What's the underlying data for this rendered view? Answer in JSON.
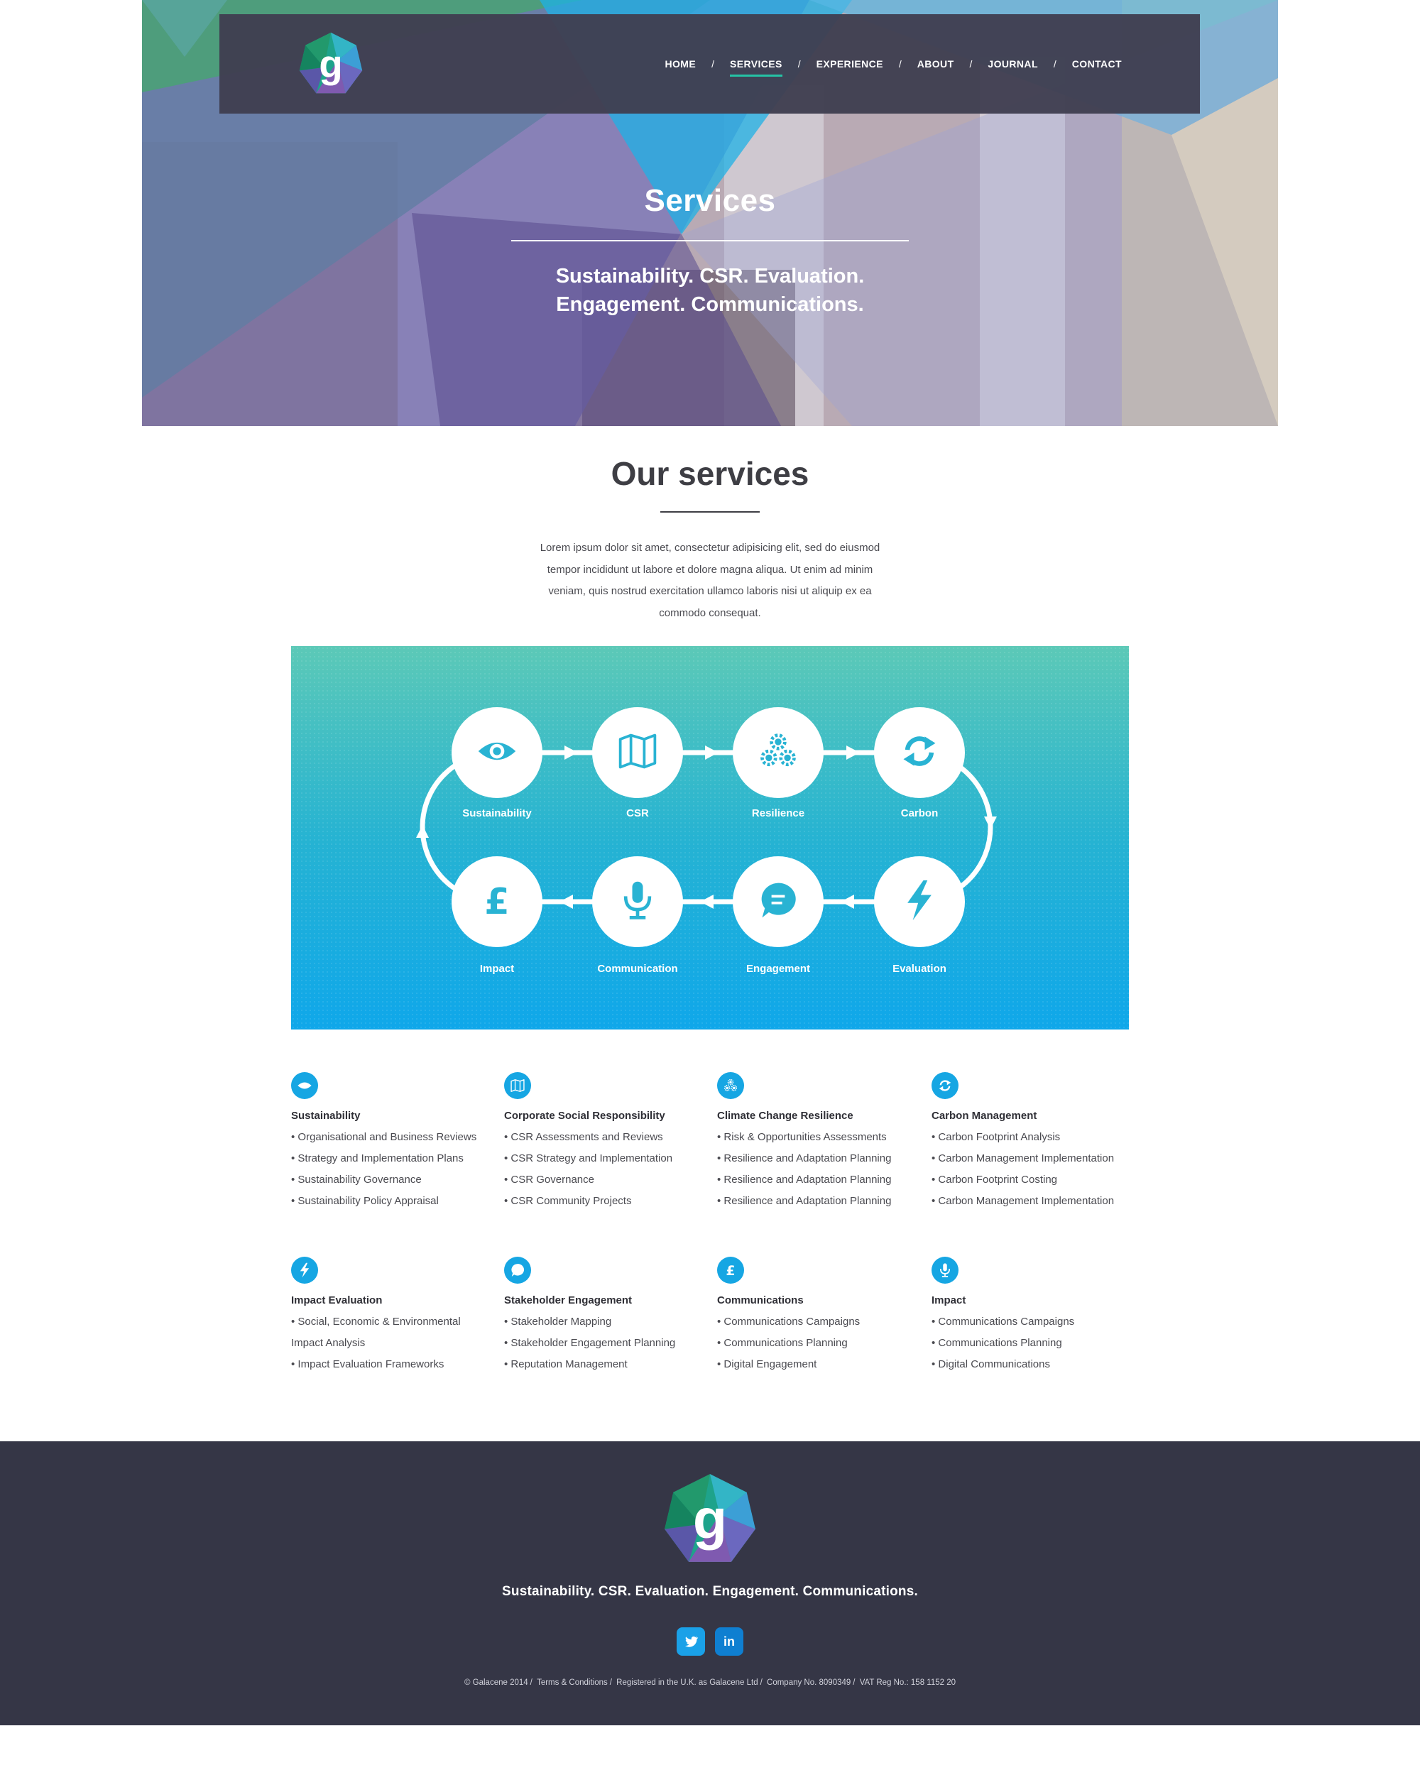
{
  "header": {
    "logo_letter": "g",
    "nav": [
      {
        "label": "HOME",
        "active": false
      },
      {
        "label": "SERVICES",
        "active": true
      },
      {
        "label": "EXPERIENCE",
        "active": false
      },
      {
        "label": "ABOUT",
        "active": false
      },
      {
        "label": "JOURNAL",
        "active": false
      },
      {
        "label": "CONTACT",
        "active": false
      }
    ],
    "nav_separator": "/"
  },
  "hero": {
    "title": "Services",
    "subtitle_line1": "Sustainability. CSR. Evaluation.",
    "subtitle_line2": "Engagement. Communications."
  },
  "services_intro": {
    "title": "Our services",
    "body": "Lorem ipsum dolor sit amet, consectetur adipisicing elit, sed do eiusmod tempor incididunt ut labore et dolore magna aliqua. Ut enim ad minim veniam, quis nostrud exercitation ullamco laboris nisi ut aliquip ex ea commodo consequat."
  },
  "diagram": {
    "top_row": [
      {
        "label": "Sustainability",
        "icon": "eye-icon"
      },
      {
        "label": "CSR",
        "icon": "map-icon"
      },
      {
        "label": "Resilience",
        "icon": "gears-icon"
      },
      {
        "label": "Carbon",
        "icon": "recycle-icon"
      }
    ],
    "bottom_row": [
      {
        "label": "Impact",
        "icon": "pound-icon"
      },
      {
        "label": "Communication",
        "icon": "microphone-icon"
      },
      {
        "label": "Engagement",
        "icon": "speech-bubble-icon"
      },
      {
        "label": "Evaluation",
        "icon": "lightning-icon"
      }
    ],
    "colors": {
      "gradient_top": "#5cc9b7",
      "gradient_bottom": "#0fa7ea"
    }
  },
  "service_columns": [
    {
      "icon": "eye-icon",
      "title": "Sustainability",
      "items": [
        "• Organisational and Business Reviews",
        "• Strategy and Implementation Plans",
        "• Sustainability Governance",
        "• Sustainability Policy Appraisal"
      ]
    },
    {
      "icon": "map-icon",
      "title": "Corporate Social Responsibility",
      "items": [
        "• CSR Assessments and Reviews",
        "• CSR Strategy and Implementation",
        "• CSR Governance",
        "• CSR Community Projects"
      ]
    },
    {
      "icon": "gears-icon",
      "title": "Climate Change Resilience",
      "items": [
        "• Risk & Opportunities Assessments",
        "• Resilience and Adaptation Planning",
        "• Resilience and Adaptation Planning",
        "• Resilience and Adaptation Planning"
      ]
    },
    {
      "icon": "recycle-icon",
      "title": "Carbon Management",
      "items": [
        "• Carbon Footprint Analysis",
        "• Carbon Management Implementation",
        "• Carbon Footprint Costing",
        "• Carbon Management Implementation"
      ]
    },
    {
      "icon": "lightning-icon",
      "title": "Impact Evaluation",
      "items": [
        "• Social, Economic & Environmental",
        "Impact Analysis",
        "• Impact Evaluation Frameworks"
      ]
    },
    {
      "icon": "speech-bubble-icon",
      "title": "Stakeholder Engagement",
      "items": [
        "• Stakeholder Mapping",
        "• Stakeholder Engagement Planning",
        "• Reputation Management"
      ]
    },
    {
      "icon": "pound-icon",
      "title": "Communications",
      "items": [
        "• Communications Campaigns",
        "• Communications Planning",
        "• Digital Engagement"
      ]
    },
    {
      "icon": "microphone-icon",
      "title": "Impact",
      "items": [
        "• Communications Campaigns",
        "• Communications Planning",
        "• Digital Communications"
      ]
    }
  ],
  "footer": {
    "logo_letter": "g",
    "tagline": "Sustainability. CSR. Evaluation. Engagement. Communications.",
    "social": [
      {
        "name": "twitter-icon"
      },
      {
        "name": "linkedin-icon",
        "label": "in"
      }
    ],
    "legal": {
      "copyright": "© Galacene 2014",
      "terms": "Terms & Conditions",
      "registered": "Registered in the U.K. as Galacene Ltd",
      "company": "Company No. 8090349",
      "vat": "VAT Reg No.: 158 1152 20"
    }
  },
  "colors": {
    "accent": "#16a6e3",
    "nav_active": "#25c3a5",
    "nav_bg": "#403e50",
    "footer_bg": "#353646",
    "text": "#3e3e44"
  }
}
